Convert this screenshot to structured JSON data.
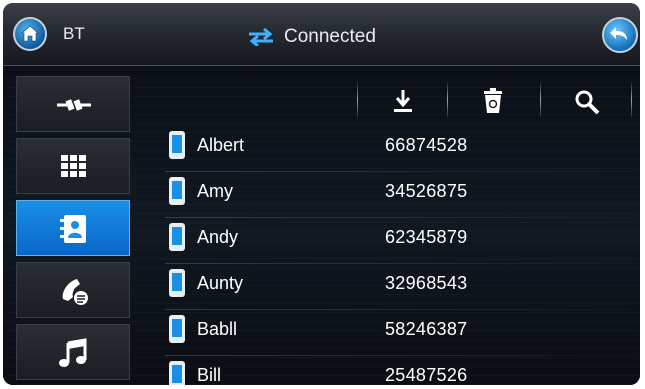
{
  "header": {
    "title": "BT",
    "connection_status": "Connected",
    "home_icon": "home-icon",
    "back_icon": "back-arrow-icon",
    "connection_icon": "transfer-arrows-icon"
  },
  "sidebar": {
    "items": [
      {
        "name": "connection",
        "icon": "plug-icon",
        "active": false
      },
      {
        "name": "dialpad",
        "icon": "dialpad-icon",
        "active": false
      },
      {
        "name": "phonebook",
        "icon": "contacts-icon",
        "active": true
      },
      {
        "name": "call-history",
        "icon": "call-log-icon",
        "active": false
      },
      {
        "name": "music",
        "icon": "music-note-icon",
        "active": false
      }
    ]
  },
  "toolbar": {
    "items": [
      {
        "name": "download",
        "icon": "download-icon"
      },
      {
        "name": "delete",
        "icon": "recycle-bin-icon"
      },
      {
        "name": "search",
        "icon": "search-icon"
      }
    ]
  },
  "contacts": [
    {
      "name": "Albert",
      "number": "66874528"
    },
    {
      "name": "Amy",
      "number": "34526875"
    },
    {
      "name": "Andy",
      "number": "62345879"
    },
    {
      "name": "Aunty",
      "number": "32968543"
    },
    {
      "name": "Babll",
      "number": "58246387"
    },
    {
      "name": "Bill",
      "number": "25487526"
    }
  ],
  "colors": {
    "accent": "#0f7fd8",
    "active_sidebar": "#1a8fe6",
    "text": "#ffffff"
  }
}
